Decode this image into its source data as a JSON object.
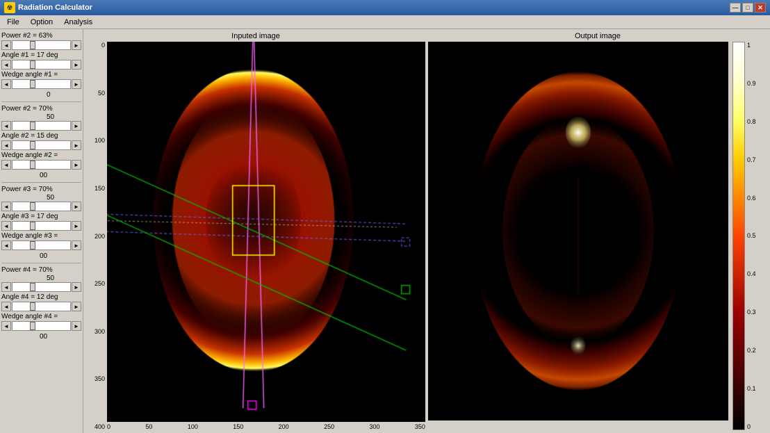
{
  "window": {
    "title": "Radiation Calculator",
    "icon": "☢"
  },
  "titlebar": {
    "minimize": "—",
    "maximize": "□",
    "close": "✕"
  },
  "menu": {
    "items": [
      "File",
      "Option",
      "Analysis"
    ]
  },
  "sidebar": {
    "beams": [
      {
        "power_label": "Power #2 = 63%",
        "angle_label": "Angle #1 = 17 deg",
        "wedge_label": "Wedge angle #1 ="
      },
      {
        "power_label": "Power #2 = 70%",
        "angle_label": "Angle #2 = 15 deg",
        "wedge_label": "Wedge angle #2 ="
      },
      {
        "power_label": "Power #3 = 70%",
        "angle_label": "Angle #3 = 17 deg",
        "wedge_label": "Wedge angle #3 ="
      },
      {
        "power_label": "Power #4 = 70%",
        "angle_label": "Angle #4 = 12 deg",
        "wedge_label": "Wedge angle #4 ="
      }
    ]
  },
  "input_image": {
    "title": "Inputed image"
  },
  "output_image": {
    "title": "Output image"
  },
  "y_axis_left": [
    "400",
    "350",
    "300",
    "250",
    "200",
    "150",
    "100",
    "50",
    "0"
  ],
  "x_axis_left": [
    "0",
    "50",
    "100",
    "150",
    "200",
    "250",
    "300",
    "350"
  ],
  "colorbar_labels": [
    "1",
    "0.9",
    "0.8",
    "0.7",
    "0.6",
    "0.5",
    "0.4",
    "0.3",
    "0.2",
    "0.1",
    "0"
  ]
}
